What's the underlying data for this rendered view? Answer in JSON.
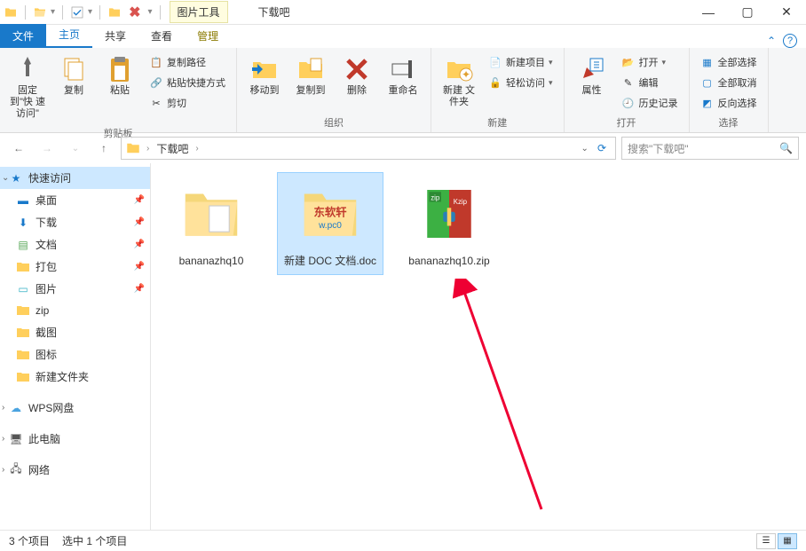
{
  "titlebar": {
    "context_tab": "图片工具",
    "title": "下载吧"
  },
  "window_controls": {
    "min": "—",
    "max": "▢",
    "close": "✕"
  },
  "tabs": {
    "file": "文件",
    "home": "主页",
    "share": "共享",
    "view": "查看",
    "manage": "管理"
  },
  "ribbon": {
    "pin": {
      "label": "固定到\"快\n速访问\""
    },
    "copy": {
      "label": "复制"
    },
    "paste": {
      "label": "粘贴"
    },
    "copypath": "复制路径",
    "pasteshortcut": "粘贴快捷方式",
    "cut": "剪切",
    "grp_clipboard": "剪贴板",
    "moveto": "移动到",
    "copyto": "复制到",
    "delete": "删除",
    "rename": "重命名",
    "grp_organize": "组织",
    "newfolder": "新建\n文件夹",
    "newitem": "新建项目",
    "easyaccess": "轻松访问",
    "grp_new": "新建",
    "properties": "属性",
    "open": "打开",
    "edit": "编辑",
    "history": "历史记录",
    "grp_open": "打开",
    "selectall": "全部选择",
    "selectnone": "全部取消",
    "invertsel": "反向选择",
    "grp_select": "选择"
  },
  "address": {
    "segment": "下载吧",
    "search_placeholder": "搜索\"下载吧\""
  },
  "sidebar": {
    "quick_access": "快速访问",
    "items": [
      {
        "label": "桌面",
        "icon": "desktop",
        "pinned": true
      },
      {
        "label": "下载",
        "icon": "download",
        "pinned": true
      },
      {
        "label": "文档",
        "icon": "document",
        "pinned": true
      },
      {
        "label": "打包",
        "icon": "folder",
        "pinned": true
      },
      {
        "label": "图片",
        "icon": "picture",
        "pinned": true
      },
      {
        "label": "zip",
        "icon": "folder",
        "pinned": false
      },
      {
        "label": "截图",
        "icon": "folder",
        "pinned": false
      },
      {
        "label": "图标",
        "icon": "folder",
        "pinned": false
      },
      {
        "label": "新建文件夹",
        "icon": "folder",
        "pinned": false
      }
    ],
    "wps": "WPS网盘",
    "thispc": "此电脑",
    "network": "网络"
  },
  "files": [
    {
      "name": "bananazhq10",
      "type": "folder",
      "selected": false
    },
    {
      "name": "新建 DOC 文档.doc",
      "type": "folder-doc",
      "selected": true
    },
    {
      "name": "bananazhq10.zip",
      "type": "zip",
      "selected": false
    }
  ],
  "status": {
    "count": "3 个项目",
    "selected": "选中 1 个项目"
  }
}
